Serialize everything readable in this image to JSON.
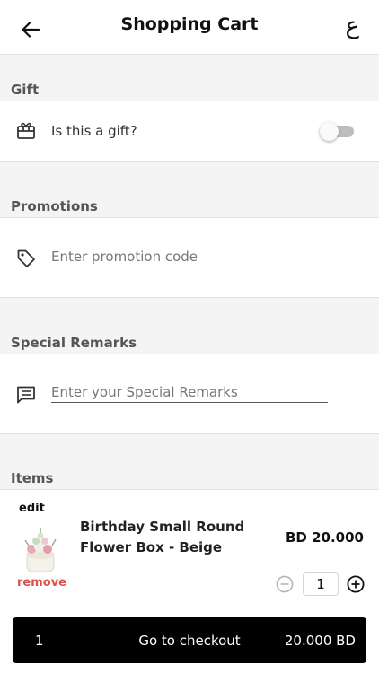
{
  "header": {
    "title": "Shopping Cart",
    "language_toggle": "ع",
    "back_icon": "arrow-left-icon"
  },
  "gift": {
    "section_title": "Gift",
    "label": "Is this a gift?",
    "icon": "gift-card-icon",
    "toggle_on": false
  },
  "promotions": {
    "section_title": "Promotions",
    "placeholder": "Enter promotion code",
    "value": "",
    "icon": "tag-icon"
  },
  "remarks": {
    "section_title": "Special Remarks",
    "placeholder": "Enter your Special Remarks",
    "value": "",
    "icon": "comment-icon"
  },
  "items": {
    "section_title": "Items",
    "list": [
      {
        "edit_label": "edit",
        "remove_label": "remove",
        "name": "Birthday Small Round Flower Box - Beige",
        "price": "BD 20.000",
        "quantity": "1"
      }
    ]
  },
  "checkout": {
    "item_count": "1",
    "label": "Go to checkout",
    "total": "20.000 BD"
  },
  "colors": {
    "remove": "#d9534f",
    "checkout_bg": "#000000",
    "section_bg": "#f4f4f4"
  }
}
